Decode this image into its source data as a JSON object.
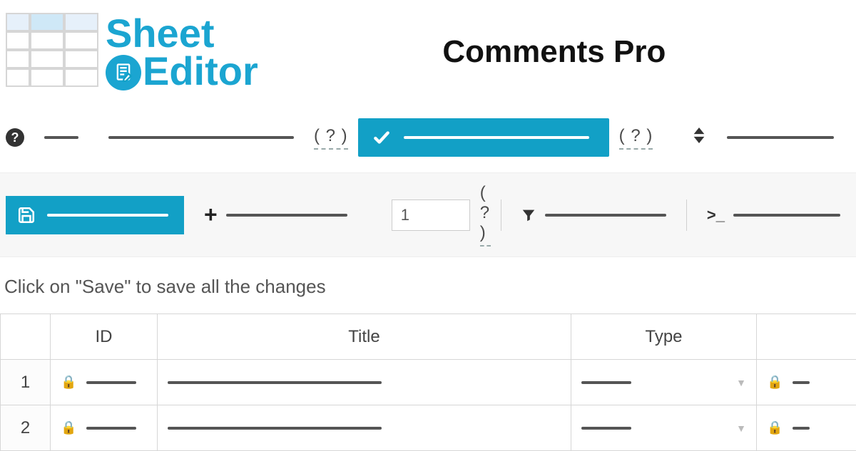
{
  "brand": {
    "line1": "Sheet",
    "line2": "Editor"
  },
  "page_title": "Comments Pro",
  "toolbar_row1": {
    "help1": "( ? )",
    "help2": "( ? )"
  },
  "toolbar_row2": {
    "page_value": "1",
    "help1": "( ? )"
  },
  "hint": "Click on \"Save\" to save all the changes",
  "table": {
    "headers": [
      "",
      "ID",
      "Title",
      "Type",
      ""
    ],
    "rows": [
      {
        "num": "1"
      },
      {
        "num": "2"
      }
    ]
  }
}
